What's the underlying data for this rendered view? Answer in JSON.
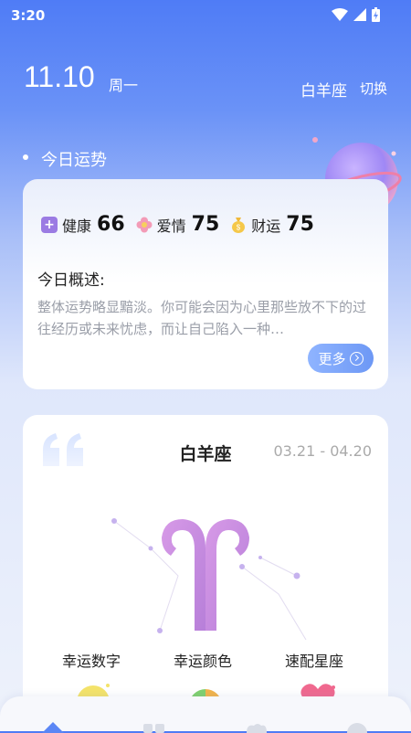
{
  "status": {
    "time": "3:20"
  },
  "header": {
    "date": "11.10",
    "weekday": "周一",
    "sign": "白羊座",
    "switch_label": "切换"
  },
  "today": {
    "section_title": "今日运势",
    "scores": [
      {
        "label": "健康",
        "value": "66",
        "icon": "health-icon"
      },
      {
        "label": "爱情",
        "value": "75",
        "icon": "flower-icon"
      },
      {
        "label": "财运",
        "value": "75",
        "icon": "money-bag-icon"
      }
    ],
    "overview_label": "今日概述:",
    "overview_text": "整体运势略显黯淡。你可能会因为心里那些放不下的过往经历或未来忧虑，而让自己陷入一种…",
    "more_label": "更多"
  },
  "sign_card": {
    "title": "白羊座",
    "date_range": "03.21 - 04.20",
    "lucky_labels": [
      "幸运数字",
      "幸运颜色",
      "速配星座"
    ]
  },
  "colors": {
    "accent": "#5b86f5",
    "aries": "#c58be0"
  }
}
